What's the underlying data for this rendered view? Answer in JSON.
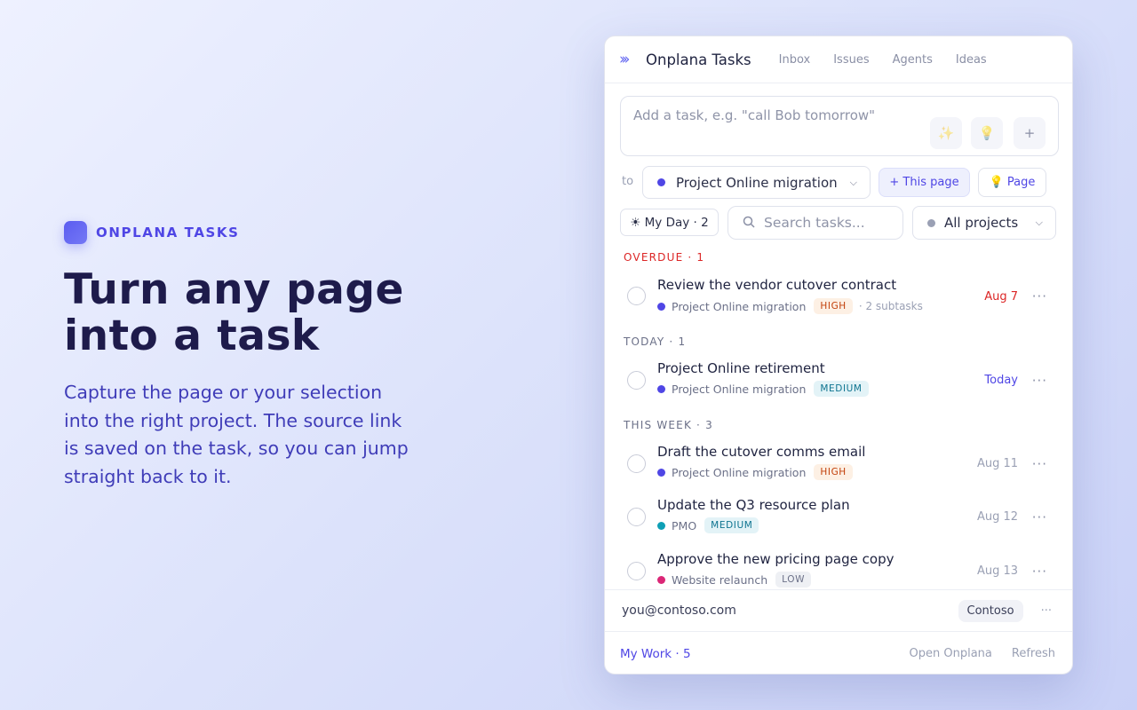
{
  "hero": {
    "brand": "ONPLANA TASKS",
    "title_line1": "Turn any page",
    "title_line2": "into a task",
    "desc_line1": "Capture the page or your selection",
    "desc_line2": "into the right project. The source link",
    "desc_line3": "is saved on the task, so you can jump",
    "desc_line4": "straight back to it."
  },
  "panel": {
    "app_title": "Onplana Tasks",
    "tabs": [
      "Inbox",
      "Issues",
      "Agents",
      "Ideas"
    ],
    "add_placeholder": "Add a task, e.g. \"call Bob tomorrow\"",
    "add_icons": [
      "✨",
      "💡",
      "+"
    ],
    "to_label": "to",
    "selected_project": "Project Online migration",
    "selected_project_color": "#4f46e5",
    "this_page_btn": "+ This page",
    "page_btn": "💡 Page",
    "my_day": "☀ My Day · 2",
    "search_placeholder": "Search tasks...",
    "all_projects": "All projects"
  },
  "sections": {
    "overdue": "OVERDUE · 1",
    "today": "TODAY · 1",
    "this_week": "THIS WEEK · 3"
  },
  "tasks": [
    {
      "title": "Review the vendor cutover contract",
      "project": "Project Online migration",
      "project_color": "#4f46e5",
      "priority": "HIGH",
      "subtasks": "· 2 subtasks",
      "date": "Aug 7"
    },
    {
      "title": "Project Online retirement",
      "project": "Project Online migration",
      "project_color": "#4f46e5",
      "priority": "MEDIUM",
      "date": "Today"
    },
    {
      "title": "Draft the cutover comms email",
      "project": "Project Online migration",
      "project_color": "#4f46e5",
      "priority": "HIGH",
      "date": "Aug 11"
    },
    {
      "title": "Update the Q3 resource plan",
      "project": "PMO",
      "project_color": "#0e9fb5",
      "priority": "MEDIUM",
      "date": "Aug 12"
    },
    {
      "title": "Approve the new pricing page copy",
      "project": "Website relaunch",
      "project_color": "#db2777",
      "priority": "LOW",
      "date": "Aug 13"
    }
  ],
  "more_glyph": "···",
  "account": {
    "email": "you@contoso.com",
    "org": "Contoso",
    "more": "···"
  },
  "footer": {
    "my_work": "My Work · 5",
    "open": "Open Onplana",
    "refresh": "Refresh"
  }
}
